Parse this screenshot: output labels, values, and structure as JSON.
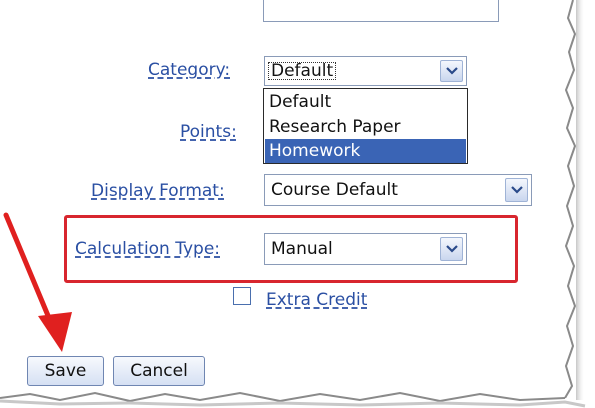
{
  "form": {
    "category": {
      "label": "Category:",
      "value": "Default",
      "options": [
        "Default",
        "Research Paper",
        "Homework"
      ],
      "highlighted_option": "Homework"
    },
    "points": {
      "label": "Points:"
    },
    "display_format": {
      "label": "Display Format:",
      "value": "Course Default"
    },
    "calculation_type": {
      "label": "Calculation Type:",
      "value": "Manual"
    },
    "extra_credit": {
      "label": "Extra Credit",
      "checked": false
    }
  },
  "buttons": {
    "save_label": "Save",
    "cancel_label": "Cancel"
  },
  "annotations": {
    "highlight_color": "#d8262e",
    "arrow_color": "#e0201f",
    "selection_color": "#3a64b5"
  }
}
